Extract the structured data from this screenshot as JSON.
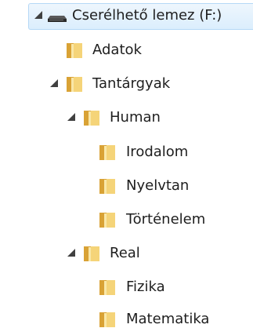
{
  "tree": {
    "drive": {
      "label": "Cserélhető lemez (F:)",
      "icon": "removable-drive-icon"
    },
    "adatok": {
      "label": "Adatok",
      "icon": "folder-icon"
    },
    "tantargyak": {
      "label": "Tantárgyak",
      "icon": "folder-icon"
    },
    "human": {
      "label": "Human",
      "icon": "folder-icon"
    },
    "irodalom": {
      "label": "Irodalom",
      "icon": "folder-icon"
    },
    "nyelvtan": {
      "label": "Nyelvtan",
      "icon": "folder-icon"
    },
    "tortenelem": {
      "label": "Történelem",
      "icon": "folder-icon"
    },
    "real": {
      "label": "Real",
      "icon": "folder-icon"
    },
    "fizika": {
      "label": "Fizika",
      "icon": "folder-icon"
    },
    "matematika": {
      "label": "Matematika",
      "icon": "folder-icon"
    }
  },
  "colors": {
    "selection_fill": "#dbeefd",
    "selection_border": "#b5d8f6",
    "folder_yellow": "#f2c95b"
  }
}
